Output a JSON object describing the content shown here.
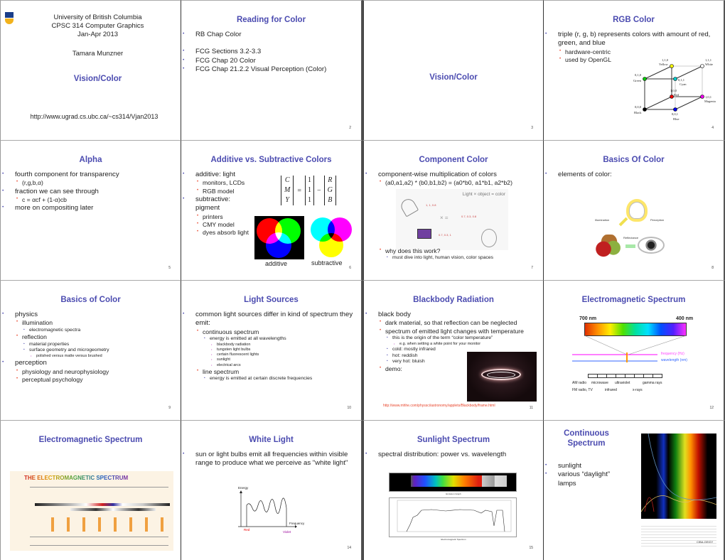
{
  "colors": {
    "title": "#4b4bb0",
    "bullet_l2": "#e8442a",
    "link": "#e8442a"
  },
  "slides": [
    {
      "page": "",
      "title": "Vision/Color",
      "header": [
        "University of British Columbia",
        "CPSC 314 Computer Graphics",
        "Jan-Apr 2013"
      ],
      "author": "Tamara Munzner",
      "url": "http://www.ugrad.cs.ubc.ca/~cs314/Vjan2013",
      "logo": "ubc-crest",
      "bullets": []
    },
    {
      "page": "2",
      "title": "Reading for Color",
      "bullets": [
        {
          "l": 1,
          "t": "RB Chap Color"
        },
        {
          "l": 1,
          "t": "FCG Sections 3.2-3.3"
        },
        {
          "l": 1,
          "t": "FCG Chap 20 Color"
        },
        {
          "l": 1,
          "t": "FCG Chap 21.2.2 Visual Perception (Color)"
        }
      ]
    },
    {
      "page": "3",
      "title": "Vision/Color",
      "bullets": []
    },
    {
      "page": "4",
      "title": "RGB Color",
      "bullets": [
        {
          "l": 1,
          "t": "triple (r, g, b) represents colors with amount of red, green, and blue"
        },
        {
          "l": 2,
          "t": "hardware-centric"
        },
        {
          "l": 2,
          "t": "used by OpenGL"
        }
      ],
      "cube": {
        "yellow": [
          "1,1,0",
          "Yellow"
        ],
        "white": [
          "1,1,1",
          "White"
        ],
        "green": [
          "0,1,0",
          "Green"
        ],
        "cyan": [
          "0,1,1",
          "Cyan"
        ],
        "red": [
          "1,0,0",
          "Red"
        ],
        "magenta": [
          "1,0,1",
          "Magenta"
        ],
        "black": [
          "0,0,0",
          "Black"
        ],
        "blue": [
          "0,0,1",
          "Blue"
        ]
      }
    },
    {
      "page": "5",
      "title": "Alpha",
      "bullets": [
        {
          "l": 1,
          "t": "fourth component for transparency"
        },
        {
          "l": 2,
          "t": "(r,g,b,α)"
        },
        {
          "l": 1,
          "t": "fraction we can see through"
        },
        {
          "l": 2,
          "t": "c = αcf + (1-α)cb"
        },
        {
          "l": 1,
          "t": "more on compositing later"
        }
      ]
    },
    {
      "page": "6",
      "title": "Additive vs. Subtractive Colors",
      "bullets": [
        {
          "l": 1,
          "t": "additive: light"
        },
        {
          "l": 2,
          "t": "monitors, LCDs"
        },
        {
          "l": 2,
          "t": "RGB model"
        },
        {
          "l": 1,
          "t": "subtractive: pigment"
        },
        {
          "l": 2,
          "t": "printers"
        },
        {
          "l": 2,
          "t": "CMY model"
        },
        {
          "l": 2,
          "t": "dyes absorb light"
        }
      ],
      "matrix": {
        "left": [
          "C",
          "M",
          "Y"
        ],
        "mid": [
          "1",
          "1",
          "1"
        ],
        "right": [
          "R",
          "G",
          "B"
        ],
        "eq": "=",
        "minus": "−"
      },
      "captions": [
        "additive",
        "subtractive"
      ]
    },
    {
      "page": "7",
      "title": "Component Color",
      "bullets": [
        {
          "l": 1,
          "t": "component-wise multiplication of colors"
        },
        {
          "l": 2,
          "t": "(a0,a1,a2) * (b0,b1,b2) = (a0*b0, a1*b1, a2*b2)"
        },
        {
          "l": 2,
          "t": "why does this work?"
        },
        {
          "l": 3,
          "t": "must dive into light, human vision, color spaces"
        }
      ],
      "figure": {
        "caption": "Light × object = color",
        "light": "1, 1, 0.8",
        "object": "0.7, 0.3, 1",
        "result": "0.7, 0.3, 0.8",
        "op": "×  ="
      }
    },
    {
      "page": "8",
      "title": "Basics Of Color",
      "bullets": [
        {
          "l": 1,
          "t": "elements of color:"
        }
      ],
      "figure": {
        "labels": [
          "Illumination",
          "Perception",
          "Reflectance"
        ]
      }
    },
    {
      "page": "9",
      "title": "Basics of Color",
      "bullets": [
        {
          "l": 1,
          "t": "physics"
        },
        {
          "l": 2,
          "t": "illumination"
        },
        {
          "l": 3,
          "t": "electromagnetic spectra"
        },
        {
          "l": 2,
          "t": "reflection"
        },
        {
          "l": 3,
          "t": "material properties"
        },
        {
          "l": 3,
          "t": "surface geometry and microgeometry"
        },
        {
          "l": 4,
          "t": "polished versus matte versus brushed"
        },
        {
          "l": 1,
          "t": "perception"
        },
        {
          "l": 2,
          "t": "physiology and neurophysiology"
        },
        {
          "l": 2,
          "t": "perceptual psychology"
        }
      ]
    },
    {
      "page": "10",
      "title": "Light Sources",
      "bullets": [
        {
          "l": 1,
          "t": "common light sources differ in kind of spectrum they emit:"
        },
        {
          "l": 2,
          "t": "continuous spectrum"
        },
        {
          "l": 3,
          "t": "energy is emitted at all wavelengths"
        },
        {
          "l": 4,
          "t": "blackbody radiation"
        },
        {
          "l": 4,
          "t": "tungsten light bulbs"
        },
        {
          "l": 4,
          "t": "certain fluorescent lights"
        },
        {
          "l": 4,
          "t": "sunlight"
        },
        {
          "l": 4,
          "t": "electrical arcs"
        },
        {
          "l": 2,
          "t": "line spectrum"
        },
        {
          "l": 3,
          "t": "energy is emitted at certain discrete frequencies"
        }
      ]
    },
    {
      "page": "11",
      "title": "Blackbody Radiation",
      "bullets": [
        {
          "l": 1,
          "t": "black body"
        },
        {
          "l": 2,
          "t": "dark material, so that reflection can be neglected"
        },
        {
          "l": 2,
          "t": "spectrum of emitted light changes with temperature"
        },
        {
          "l": 3,
          "t": "this is the origin of the term “color temperature”"
        },
        {
          "l": 4,
          "t": "e.g. when setting a white point for your monitor"
        },
        {
          "l": 3,
          "t": "cold: mostly infrared"
        },
        {
          "l": 3,
          "t": "hot: reddish"
        },
        {
          "l": 3,
          "t": "very hot: bluish"
        },
        {
          "l": 2,
          "t": "demo:"
        }
      ],
      "url": "http://www.mhhe.com/physsci/astronomy/applets/Blackbody/frame.html"
    },
    {
      "page": "12",
      "title": "Electromagnetic Spectrum",
      "bullets": [],
      "figure": {
        "left": "700 nm",
        "right": "400 nm",
        "freq": "frequency (Hz)",
        "wave": "wavelength (nm)",
        "bands": [
          "AM radio",
          "microwave",
          "ultraviolet",
          "gamma rays",
          "FM radio, TV",
          "infrared",
          "x-rays"
        ]
      }
    },
    {
      "page": "",
      "title": "Electromagnetic Spectrum",
      "bullets": [],
      "figure": {
        "heading": "THE ELECTROMAGNETIC SPECTRUM"
      }
    },
    {
      "page": "14",
      "title": "White Light",
      "bullets": [
        {
          "l": 1,
          "t": "sun or light bulbs emit all frequencies within visible range to produce what we perceive as \"white light\""
        }
      ],
      "graph": {
        "y": "Energy",
        "x": "Frequency",
        "left": "Red",
        "right": "Violet"
      }
    },
    {
      "page": "15",
      "title": "Sunlight Spectrum",
      "bullets": [
        {
          "l": 1,
          "t": "spectral distribution: power vs. wavelength"
        }
      ],
      "figure": {
        "top_caption": "Emission Graph",
        "bottom_caption": "Electromagnetic Spectrum"
      }
    },
    {
      "page": "",
      "title": "Continuous Spectrum",
      "bullets": [
        {
          "l": 1,
          "t": "sunlight"
        },
        {
          "l": 1,
          "t": "various “daylight” lamps"
        }
      ],
      "figure": {
        "brand": "CIBA-GEIGY"
      }
    }
  ]
}
